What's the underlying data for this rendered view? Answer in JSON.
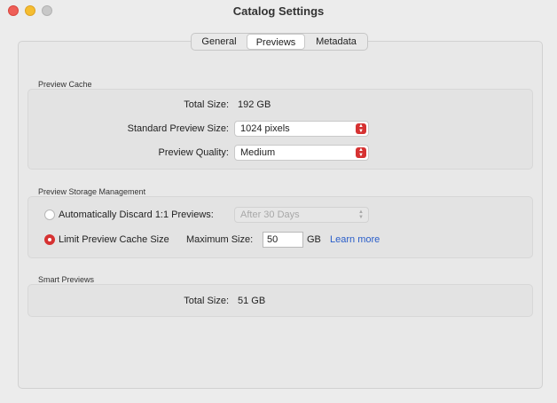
{
  "window": {
    "title": "Catalog Settings"
  },
  "tabs": [
    {
      "label": "General"
    },
    {
      "label": "Previews",
      "selected": true
    },
    {
      "label": "Metadata"
    }
  ],
  "preview_cache": {
    "section_label": "Preview Cache",
    "total_size_label": "Total Size:",
    "total_size_value": "192 GB",
    "standard_size_label": "Standard Preview Size:",
    "standard_size_value": "1024 pixels",
    "quality_label": "Preview Quality:",
    "quality_value": "Medium"
  },
  "storage": {
    "section_label": "Preview Storage Management",
    "auto_discard_label": "Automatically Discard 1:1 Previews:",
    "auto_discard_value": "After 30 Days",
    "limit_label": "Limit Preview Cache Size",
    "max_size_label": "Maximum Size:",
    "max_size_value": "50",
    "unit": "GB",
    "learn_more": "Learn more"
  },
  "smart_previews": {
    "section_label": "Smart Previews",
    "total_size_label": "Total Size:",
    "total_size_value": "51 GB"
  },
  "colors": {
    "accent": "#d63232",
    "link": "#2a5ec9"
  }
}
